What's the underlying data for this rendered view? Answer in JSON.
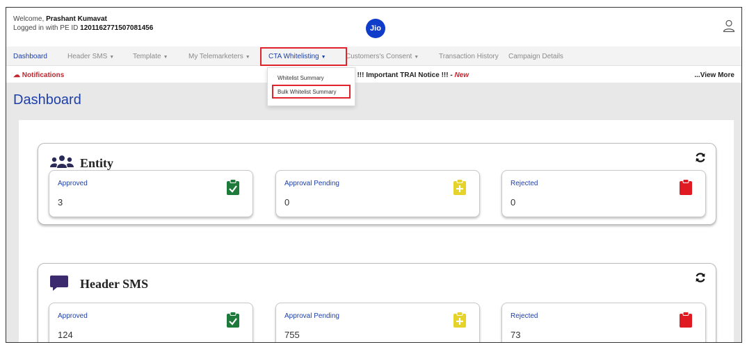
{
  "header": {
    "welcome_prefix": "Welcome,",
    "user_name": "Prashant Kumavat",
    "logged_in_prefix": "Logged in with PE ID",
    "pe_id": "1201162771507081456",
    "logo_text": "Jio"
  },
  "nav": {
    "items": [
      {
        "label": "Dashboard",
        "has_caret": false
      },
      {
        "label": "Header SMS",
        "has_caret": true
      },
      {
        "label": "Template",
        "has_caret": true
      },
      {
        "label": "My Telemarketers",
        "has_caret": true
      },
      {
        "label": "CTA Whitelisting",
        "has_caret": true
      },
      {
        "label": "Customers's Consent",
        "has_caret": true
      },
      {
        "label": "Transaction History",
        "has_caret": false
      },
      {
        "label": "Campaign Details",
        "has_caret": false
      }
    ],
    "caret": "▼"
  },
  "dropdown": {
    "items": [
      "Whitelist Summary",
      "Bulk Whitelist Summary"
    ]
  },
  "notifications": {
    "label": "Notifications",
    "text": "024 !!! Important TRAI Notice !!! - ",
    "new_tag": "New",
    "view_more": "...View More"
  },
  "page": {
    "title": "Dashboard"
  },
  "sections": [
    {
      "title": "Entity",
      "icon": "users-icon",
      "cards": [
        {
          "label": "Approved",
          "value": "3",
          "icon": "clipboard-check-icon",
          "color": "#1d7a3a"
        },
        {
          "label": "Approval Pending",
          "value": "0",
          "icon": "clipboard-plus-icon",
          "color": "#e6d32a"
        },
        {
          "label": "Rejected",
          "value": "0",
          "icon": "clipboard-icon",
          "color": "#e01a22"
        }
      ]
    },
    {
      "title": "Header SMS",
      "icon": "message-icon",
      "cards": [
        {
          "label": "Approved",
          "value": "124",
          "icon": "clipboard-check-icon",
          "color": "#1d7a3a"
        },
        {
          "label": "Approval Pending",
          "value": "755",
          "icon": "clipboard-plus-icon",
          "color": "#e6d32a"
        },
        {
          "label": "Rejected",
          "value": "73",
          "icon": "clipboard-icon",
          "color": "#e01a22"
        }
      ]
    }
  ],
  "colors": {
    "brand_blue": "#1d3fa8",
    "highlight_red": "#e1232c",
    "logo_blue": "#0f3cc9"
  }
}
